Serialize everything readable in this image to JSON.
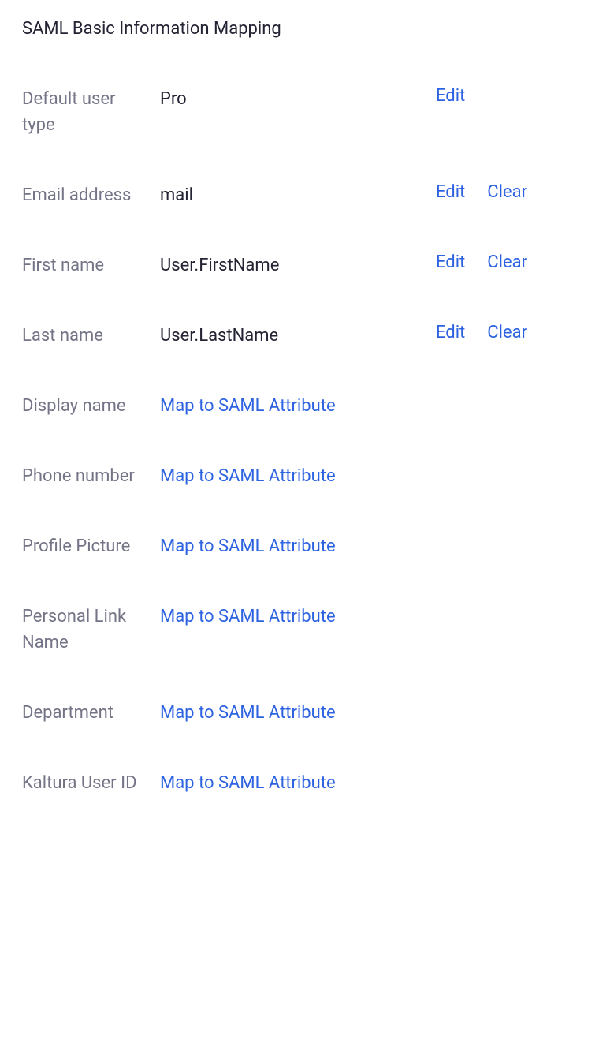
{
  "title": "SAML Basic Information Mapping",
  "map_link_text": "Map to SAML Attribute",
  "edit_text": "Edit",
  "clear_text": "Clear",
  "rows": {
    "default_user_type": {
      "label": "Default user type",
      "value": "Pro"
    },
    "email_address": {
      "label": "Email address",
      "value": "mail"
    },
    "first_name": {
      "label": "First name",
      "value": "User.FirstName"
    },
    "last_name": {
      "label": "Last name",
      "value": "User.LastName"
    },
    "display_name": {
      "label": "Display name"
    },
    "phone_number": {
      "label": "Phone number"
    },
    "profile_picture": {
      "label": "Profile Picture"
    },
    "personal_link_name": {
      "label": "Personal Link Name"
    },
    "department": {
      "label": "Department"
    },
    "kaltura_user_id": {
      "label": "Kaltura User ID"
    }
  }
}
